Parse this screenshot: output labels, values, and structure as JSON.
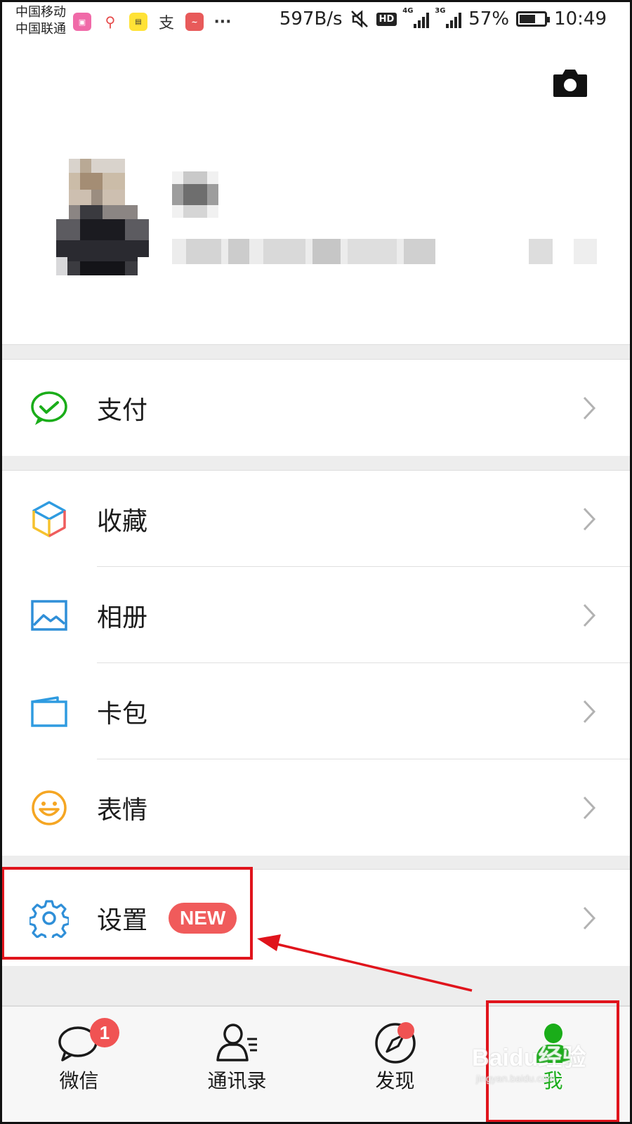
{
  "status_bar": {
    "carrier_1": "中国移动",
    "carrier_2": "中国联通",
    "net_speed": "597B/s",
    "hd": "HD",
    "net1": "4G",
    "net2": "3G",
    "battery": "57%",
    "time": "10:49",
    "more": "···"
  },
  "menu": {
    "pay": "支付",
    "favorites": "收藏",
    "album": "相册",
    "cards": "卡包",
    "stickers": "表情",
    "settings": "设置",
    "settings_badge": "NEW"
  },
  "tabbar": {
    "chats": "微信",
    "chats_badge": "1",
    "contacts": "通讯录",
    "discover": "发现",
    "me": "我"
  },
  "watermark": {
    "brand": "Baidu经验",
    "url": "jingyan.baidu.com"
  },
  "colors": {
    "accent_green": "#1aad19",
    "badge_red": "#f05353",
    "annotation_red": "#e0141c"
  }
}
